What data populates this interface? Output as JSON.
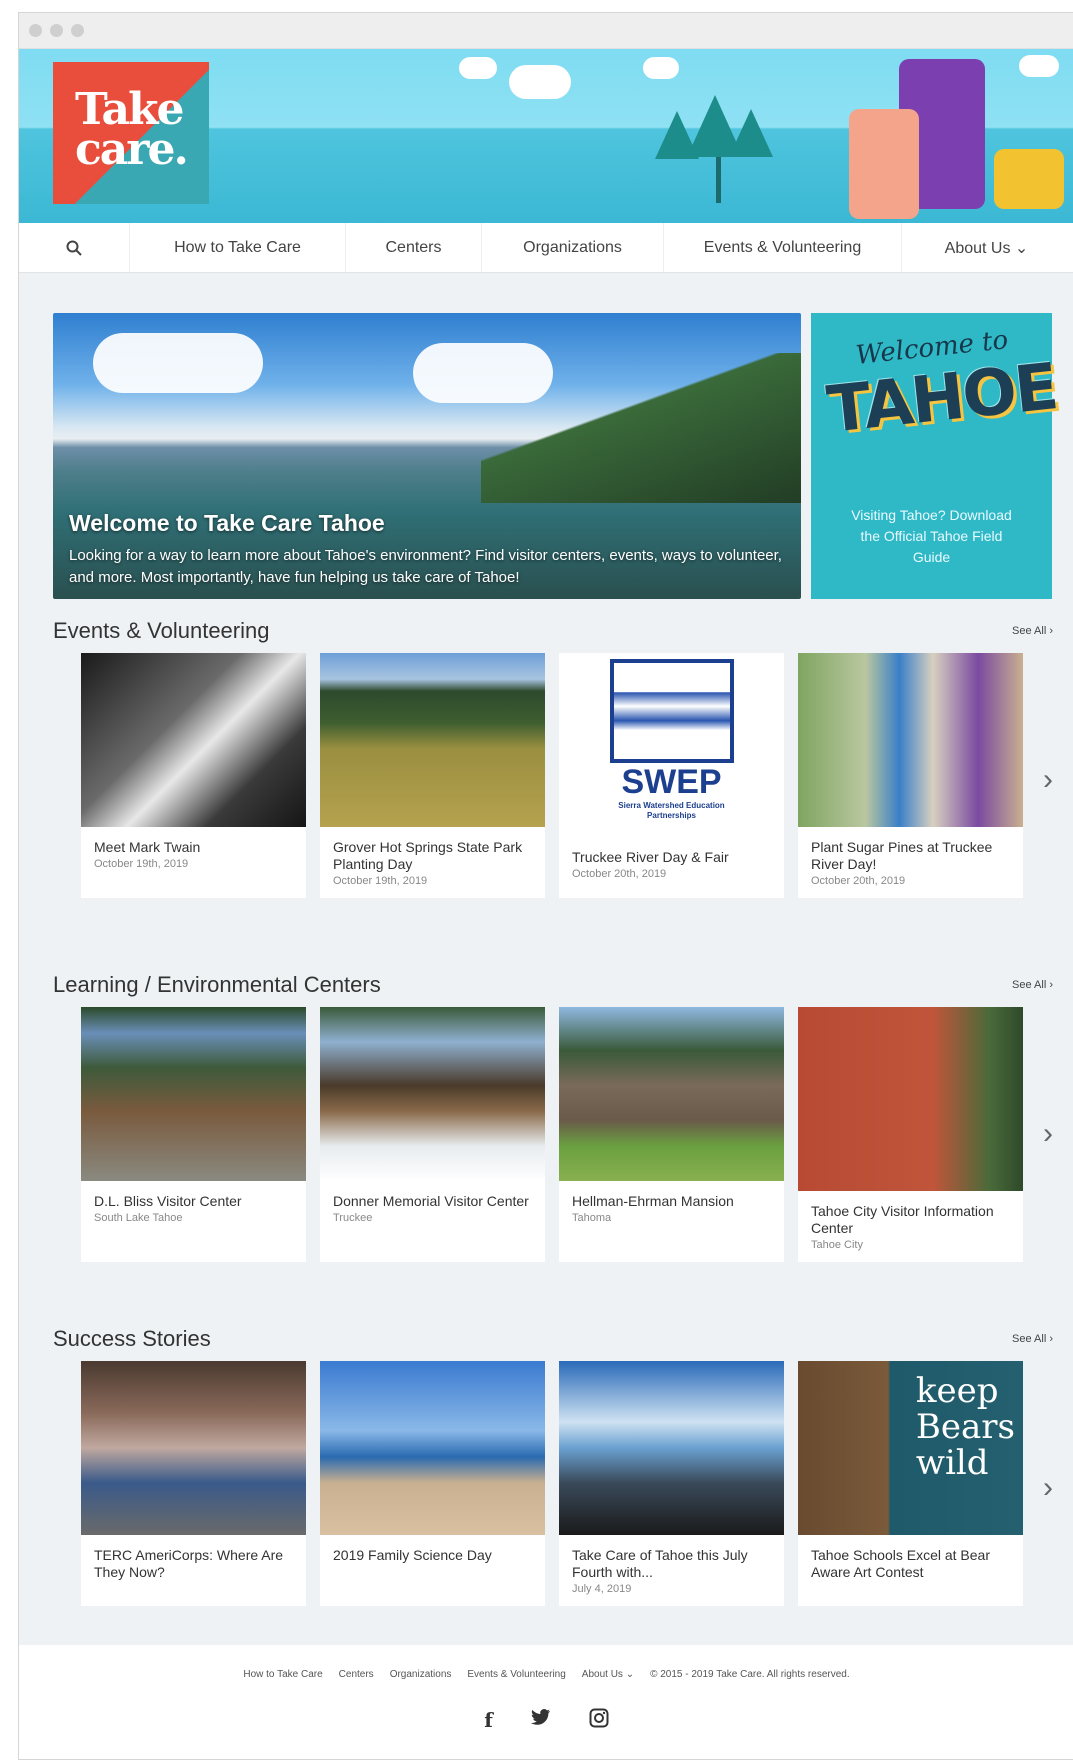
{
  "brand": {
    "logo_line1": "Take",
    "logo_line2": "care."
  },
  "nav": {
    "items": [
      {
        "label": "How to Take Care"
      },
      {
        "label": "Centers"
      },
      {
        "label": "Organizations"
      },
      {
        "label": "Events & Volunteering"
      },
      {
        "label": "About Us ⌄"
      }
    ]
  },
  "hero": {
    "title": "Welcome to Take Care Tahoe",
    "description": "Looking for a way to learn more about Tahoe's environment? Find visitor centers, events, ways to volunteer, and more. Most importantly, have fun helping us take care of Tahoe!"
  },
  "promo": {
    "script": "Welcome to",
    "big": "TAHOE",
    "copy": "Visiting Tahoe? Download the Official Tahoe Field Guide"
  },
  "sections": [
    {
      "title": "Events & Volunteering",
      "see_all": "See All ›",
      "cards": [
        {
          "title": "Meet Mark Twain",
          "meta": "October 19th, 2019"
        },
        {
          "title": "Grover Hot Springs State Park Planting Day",
          "meta": "October 19th, 2019"
        },
        {
          "title": "Truckee River Day & Fair",
          "meta": "October 20th, 2019"
        },
        {
          "title": "Plant Sugar Pines at Truckee River Day!",
          "meta": "October 20th, 2019"
        }
      ]
    },
    {
      "title": "Learning / Environmental Centers",
      "see_all": "See All ›",
      "cards": [
        {
          "title": "D.L. Bliss Visitor Center",
          "meta": "South Lake Tahoe"
        },
        {
          "title": "Donner Memorial Visitor Center",
          "meta": "Truckee"
        },
        {
          "title": "Hellman-Ehrman Mansion",
          "meta": "Tahoma"
        },
        {
          "title": "Tahoe City Visitor Information Center",
          "meta": "Tahoe City"
        }
      ]
    },
    {
      "title": "Success Stories",
      "see_all": "See All ›",
      "cards": [
        {
          "title": "TERC AmeriCorps: Where Are They Now?",
          "meta": ""
        },
        {
          "title": "2019 Family Science Day",
          "meta": ""
        },
        {
          "title": "Take Care of Tahoe this July Fourth with...",
          "meta": "July 4, 2019"
        },
        {
          "title": "Tahoe Schools Excel at Bear Aware Art Contest",
          "meta": ""
        }
      ]
    }
  ],
  "swep": {
    "name": "SWEP",
    "subtitle": "Sierra Watershed Education Partnerships"
  },
  "bear_sign": {
    "line1": "keep",
    "line2": "Bears",
    "line3": "wild"
  },
  "footer": {
    "links": [
      "How to Take Care",
      "Centers",
      "Organizations",
      "Events & Volunteering",
      "About Us ⌄"
    ],
    "copyright": "© 2015 - 2019 Take Care. All rights reserved."
  },
  "icons": {
    "search": "search-icon",
    "facebook": "facebook-icon",
    "twitter": "twitter-icon",
    "instagram": "instagram-icon",
    "next": "chevron-right-icon"
  }
}
